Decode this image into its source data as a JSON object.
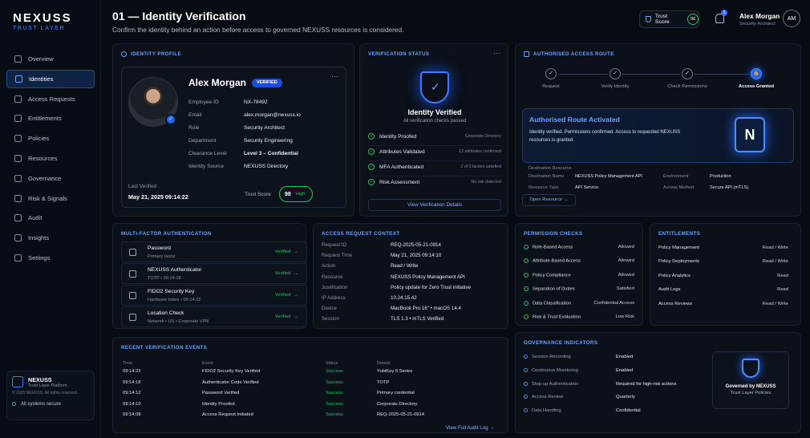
{
  "brand": {
    "name": "NEXUSS",
    "tagline": "TRUST LAYER"
  },
  "nav": [
    {
      "label": "Overview",
      "icon": "home-icon",
      "active": false
    },
    {
      "label": "Identities",
      "icon": "user-icon",
      "active": true
    },
    {
      "label": "Access Requests",
      "icon": "inbox-icon",
      "active": false
    },
    {
      "label": "Entitlements",
      "icon": "key-icon",
      "active": false
    },
    {
      "label": "Policies",
      "icon": "shield-icon",
      "active": false
    },
    {
      "label": "Resources",
      "icon": "database-icon",
      "active": false
    },
    {
      "label": "Governance",
      "icon": "scale-icon",
      "active": false
    },
    {
      "label": "Risk & Signals",
      "icon": "signal-icon",
      "active": false
    },
    {
      "label": "Audit",
      "icon": "clipboard-icon",
      "active": false
    },
    {
      "label": "Insights",
      "icon": "chart-icon",
      "active": false
    },
    {
      "label": "Settings",
      "icon": "gear-icon",
      "active": false
    }
  ],
  "sidebar_footer": {
    "name": "NEXUSS",
    "sub": "Trust Layer Platform",
    "copyright": "© 2025 NEXUSS. All rights reserved.",
    "status": "All systems secure"
  },
  "header": {
    "title": "01 — Identity Verification",
    "subtitle": "Confirm the identity behind an action before access to governed NEXUSS resources is considered.",
    "trust_label": "Trust Score",
    "trust_value": "96",
    "notifications": "3",
    "user_name": "Alex Morgan",
    "user_role": "Security Architect",
    "user_initials": "AM"
  },
  "profile": {
    "heading": "IDENTITY PROFILE",
    "name": "Alex Morgan",
    "badge": "VERIFIED",
    "fields": [
      {
        "k": "Employee ID",
        "v": "NX-78492"
      },
      {
        "k": "Email",
        "v": "alex.morgan@nexuss.io"
      },
      {
        "k": "Role",
        "v": "Security Architect"
      },
      {
        "k": "Department",
        "v": "Security Engineering"
      },
      {
        "k": "Clearance Level",
        "v": "Level 3 – Confidential"
      },
      {
        "k": "Identity Source",
        "v": "NEXUSS Directory"
      }
    ],
    "last_verified_label": "Last Verified",
    "last_verified": "May 21, 2025 09:14:22",
    "trust_label": "Trust Score",
    "trust_value": "98",
    "trust_level": "High"
  },
  "verification": {
    "heading": "VERIFICATION STATUS",
    "title": "Identity Verified",
    "subtitle": "All verification checks passed",
    "checks": [
      {
        "label": "Identity Proofed",
        "detail": "Corporate Directory"
      },
      {
        "label": "Attributes Validated",
        "detail": "12 attributes confirmed"
      },
      {
        "label": "MFA Authenticated",
        "detail": "2 of 3 factors satisfied"
      },
      {
        "label": "Risk Assessment",
        "detail": "No risk detected"
      }
    ],
    "button": "View Verification Details"
  },
  "route": {
    "heading": "AUTHORISED ACCESS ROUTE",
    "steps": [
      "Request",
      "Verify Identity",
      "Check Permissions",
      "Access Granted"
    ],
    "activated_title": "Authorised Route Activated",
    "activated_text": "Identity verified. Permissions confirmed. Access to requested NEXUSS resources is granted.",
    "dest_heading": "Destination Resource",
    "dest": [
      {
        "k": "Destination Name",
        "v": "NEXUSS Policy Management API"
      },
      {
        "k": "Resource Type",
        "v": "API Service"
      },
      {
        "k": "Environment",
        "v": "Production"
      },
      {
        "k": "Access Method",
        "v": "Secure API (mTLS)"
      }
    ],
    "open_button": "Open Resource"
  },
  "mfa": {
    "heading": "MULTI-FACTOR AUTHENTICATION",
    "factors": [
      {
        "name": "Password",
        "meta": "Primary factor",
        "status": "Verified"
      },
      {
        "name": "NEXUSS Authenticator",
        "meta": "TOTP • 09:14:18",
        "status": "Verified"
      },
      {
        "name": "FIDO2 Security Key",
        "meta": "Hardware token • 09:14:22",
        "status": "Verified"
      },
      {
        "name": "Location Check",
        "meta": "Network • US • Corporate VPN",
        "status": "Verified"
      }
    ]
  },
  "context": {
    "heading": "ACCESS REQUEST CONTEXT",
    "rows": [
      {
        "k": "Request ID",
        "v": "REQ-2025-05-21-0914"
      },
      {
        "k": "Request Time",
        "v": "May 21, 2025 09:14:10"
      },
      {
        "k": "Action",
        "v": "Read / Write"
      },
      {
        "k": "Resource",
        "v": "NEXUSS Policy Management API"
      },
      {
        "k": "Justification",
        "v": "Policy update for Zero Trust initiative"
      },
      {
        "k": "IP Address",
        "v": "10.24.15.42"
      },
      {
        "k": "Device",
        "v": "MacBook Pro 16\" • macOS 14.4"
      },
      {
        "k": "Session",
        "v": "TLS 1.3 • mTLS Verified"
      }
    ]
  },
  "permissions": {
    "heading": "PERMISSION CHECKS",
    "rows": [
      {
        "k": "Role-Based Access",
        "v": "Allowed"
      },
      {
        "k": "Attribute-Based Access",
        "v": "Allowed"
      },
      {
        "k": "Policy Compliance",
        "v": "Allowed"
      },
      {
        "k": "Separation of Duties",
        "v": "Satisfied"
      },
      {
        "k": "Data Classification",
        "v": "Confidential Access"
      },
      {
        "k": "Risk & Trust Evaluation",
        "v": "Low Risk"
      }
    ]
  },
  "entitlements": {
    "heading": "ENTITLEMENTS",
    "rows": [
      {
        "k": "Policy Management",
        "v": "Read / Write"
      },
      {
        "k": "Policy Deployments",
        "v": "Read / Write"
      },
      {
        "k": "Policy Analytics",
        "v": "Read"
      },
      {
        "k": "Audit Logs",
        "v": "Read"
      },
      {
        "k": "Access Reviews",
        "v": "Read / Write"
      }
    ]
  },
  "events": {
    "heading": "RECENT VERIFICATION EVENTS",
    "columns": [
      "Time",
      "Event",
      "Status",
      "Details"
    ],
    "rows": [
      [
        "09:14:22",
        "FIDO2 Security Key Verified",
        "Success",
        "YubiKey 5 Series"
      ],
      [
        "09:14:18",
        "Authenticator Code Verified",
        "Success",
        "TOTP"
      ],
      [
        "09:14:12",
        "Password Verified",
        "Success",
        "Primary credential"
      ],
      [
        "09:14:10",
        "Identity Proofed",
        "Success",
        "Corporate Directory"
      ],
      [
        "09:14:08",
        "Access Request Initiated",
        "Success",
        "REQ-2025-05-21-0914"
      ]
    ],
    "link": "View Full Audit Log"
  },
  "governance": {
    "heading": "GOVERNANCE INDICATORS",
    "rows": [
      {
        "k": "Session Recording",
        "v": "Enabled"
      },
      {
        "k": "Continuous Monitoring",
        "v": "Enabled"
      },
      {
        "k": "Step-up Authentication",
        "v": "Required for high-risk actions"
      },
      {
        "k": "Access Review",
        "v": "Quarterly"
      },
      {
        "k": "Data Handling",
        "v": "Confidential"
      }
    ],
    "card_title": "Governed by NEXUSS",
    "card_sub": "Trust Layer Policies"
  },
  "colors": {
    "accent": "#2563eb",
    "success": "#22c55e",
    "background": "#070b12"
  }
}
